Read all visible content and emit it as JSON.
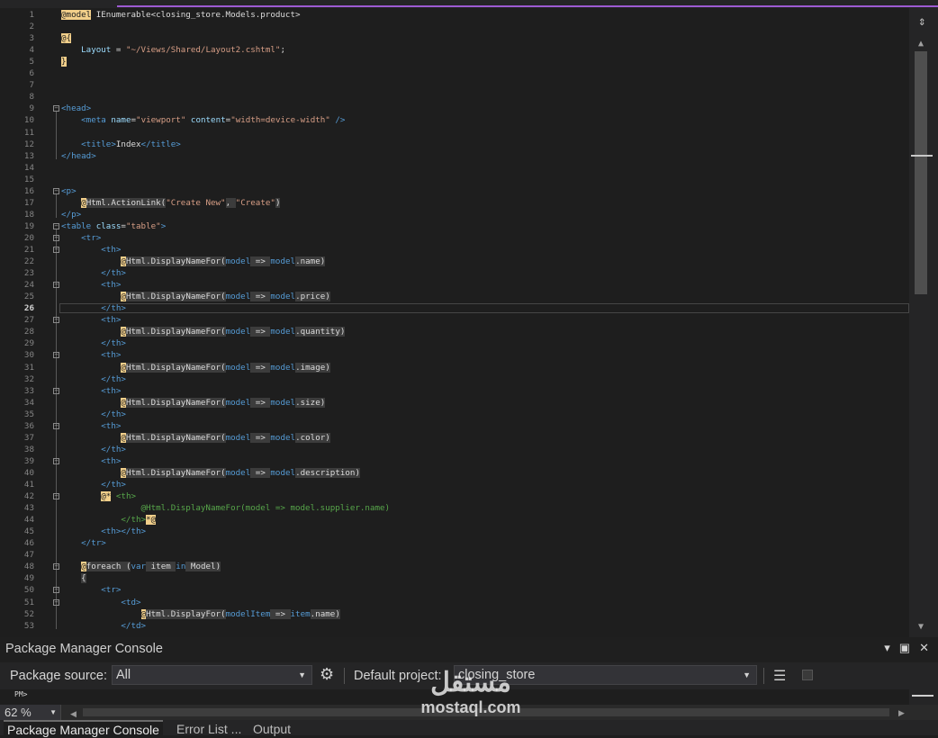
{
  "editor": {
    "current_line": 26,
    "lines": [
      {
        "n": 1,
        "segs": [
          [
            "razor",
            "@model"
          ],
          [
            "type",
            " IEnumerable<closing_store.Models.product>"
          ]
        ]
      },
      {
        "n": 2,
        "segs": []
      },
      {
        "n": 3,
        "segs": [
          [
            "razor",
            "@{"
          ]
        ]
      },
      {
        "n": 4,
        "segs": [
          [
            "plain",
            "    "
          ],
          [
            "prop",
            "Layout"
          ],
          [
            "plain",
            " = "
          ],
          [
            "str",
            "\"~/Views/Shared/Layout2.cshtml\""
          ],
          [
            "plain",
            ";"
          ]
        ]
      },
      {
        "n": 5,
        "segs": [
          [
            "razor",
            "}"
          ]
        ]
      },
      {
        "n": 6,
        "segs": []
      },
      {
        "n": 7,
        "segs": []
      },
      {
        "n": 8,
        "segs": []
      },
      {
        "n": 9,
        "segs": [
          [
            "tag",
            "<head>"
          ]
        ]
      },
      {
        "n": 10,
        "segs": [
          [
            "plain",
            "    "
          ],
          [
            "tag",
            "<meta "
          ],
          [
            "attr",
            "name"
          ],
          [
            "plain",
            "="
          ],
          [
            "str",
            "\"viewport\""
          ],
          [
            "plain",
            " "
          ],
          [
            "attr",
            "content"
          ],
          [
            "plain",
            "="
          ],
          [
            "str",
            "\"width=device-width\""
          ],
          [
            "tag",
            " />"
          ]
        ]
      },
      {
        "n": 11,
        "segs": []
      },
      {
        "n": 12,
        "segs": [
          [
            "plain",
            "    "
          ],
          [
            "tag",
            "<title>"
          ],
          [
            "plain",
            "Index"
          ],
          [
            "tag",
            "</title>"
          ]
        ]
      },
      {
        "n": 13,
        "segs": [
          [
            "tag",
            "</head>"
          ]
        ]
      },
      {
        "n": 14,
        "segs": []
      },
      {
        "n": 15,
        "segs": []
      },
      {
        "n": 16,
        "segs": [
          [
            "tag",
            "<p>"
          ]
        ]
      },
      {
        "n": 17,
        "segs": [
          [
            "plain",
            "    "
          ],
          [
            "razor",
            "@"
          ],
          [
            "rzb",
            "Html.ActionLink("
          ],
          [
            "str",
            "\"Create New\""
          ],
          [
            "rzb",
            ", "
          ],
          [
            "str",
            "\"Create\""
          ],
          [
            "rzb",
            ")"
          ]
        ]
      },
      {
        "n": 18,
        "segs": [
          [
            "tag",
            "</p>"
          ]
        ]
      },
      {
        "n": 19,
        "segs": [
          [
            "tag",
            "<table "
          ],
          [
            "attr",
            "class"
          ],
          [
            "plain",
            "="
          ],
          [
            "str",
            "\"table\""
          ],
          [
            "tag",
            ">"
          ]
        ]
      },
      {
        "n": 20,
        "segs": [
          [
            "plain",
            "    "
          ],
          [
            "tag",
            "<tr>"
          ]
        ]
      },
      {
        "n": 21,
        "segs": [
          [
            "plain",
            "        "
          ],
          [
            "tag",
            "<th>"
          ]
        ]
      },
      {
        "n": 22,
        "segs": [
          [
            "plain",
            "            "
          ],
          [
            "razor",
            "@"
          ],
          [
            "rzb",
            "Html.DisplayNameFor("
          ],
          [
            "kw",
            "model"
          ],
          [
            "rzb",
            " => "
          ],
          [
            "kw",
            "model"
          ],
          [
            "rzb",
            ".name)"
          ]
        ]
      },
      {
        "n": 23,
        "segs": [
          [
            "plain",
            "        "
          ],
          [
            "tag",
            "</th>"
          ]
        ]
      },
      {
        "n": 24,
        "segs": [
          [
            "plain",
            "        "
          ],
          [
            "tag",
            "<th>"
          ]
        ]
      },
      {
        "n": 25,
        "segs": [
          [
            "plain",
            "            "
          ],
          [
            "razor",
            "@"
          ],
          [
            "rzb",
            "Html.DisplayNameFor("
          ],
          [
            "kw",
            "model"
          ],
          [
            "rzb",
            " => "
          ],
          [
            "kw",
            "model"
          ],
          [
            "rzb",
            ".price)"
          ]
        ]
      },
      {
        "n": 26,
        "segs": [
          [
            "plain",
            "        "
          ],
          [
            "tag",
            "</th>"
          ]
        ]
      },
      {
        "n": 27,
        "segs": [
          [
            "plain",
            "        "
          ],
          [
            "tag",
            "<th>"
          ]
        ]
      },
      {
        "n": 28,
        "segs": [
          [
            "plain",
            "            "
          ],
          [
            "razor",
            "@"
          ],
          [
            "rzb",
            "Html.DisplayNameFor("
          ],
          [
            "kw",
            "model"
          ],
          [
            "rzb",
            " => "
          ],
          [
            "kw",
            "model"
          ],
          [
            "rzb",
            ".quantity)"
          ]
        ]
      },
      {
        "n": 29,
        "segs": [
          [
            "plain",
            "        "
          ],
          [
            "tag",
            "</th>"
          ]
        ]
      },
      {
        "n": 30,
        "segs": [
          [
            "plain",
            "        "
          ],
          [
            "tag",
            "<th>"
          ]
        ]
      },
      {
        "n": 31,
        "segs": [
          [
            "plain",
            "            "
          ],
          [
            "razor",
            "@"
          ],
          [
            "rzb",
            "Html.DisplayNameFor("
          ],
          [
            "kw",
            "model"
          ],
          [
            "rzb",
            " => "
          ],
          [
            "kw",
            "model"
          ],
          [
            "rzb",
            ".image)"
          ]
        ]
      },
      {
        "n": 32,
        "segs": [
          [
            "plain",
            "        "
          ],
          [
            "tag",
            "</th>"
          ]
        ]
      },
      {
        "n": 33,
        "segs": [
          [
            "plain",
            "        "
          ],
          [
            "tag",
            "<th>"
          ]
        ]
      },
      {
        "n": 34,
        "segs": [
          [
            "plain",
            "            "
          ],
          [
            "razor",
            "@"
          ],
          [
            "rzb",
            "Html.DisplayNameFor("
          ],
          [
            "kw",
            "model"
          ],
          [
            "rzb",
            " => "
          ],
          [
            "kw",
            "model"
          ],
          [
            "rzb",
            ".size)"
          ]
        ]
      },
      {
        "n": 35,
        "segs": [
          [
            "plain",
            "        "
          ],
          [
            "tag",
            "</th>"
          ]
        ]
      },
      {
        "n": 36,
        "segs": [
          [
            "plain",
            "        "
          ],
          [
            "tag",
            "<th>"
          ]
        ]
      },
      {
        "n": 37,
        "segs": [
          [
            "plain",
            "            "
          ],
          [
            "razor",
            "@"
          ],
          [
            "rzb",
            "Html.DisplayNameFor("
          ],
          [
            "kw",
            "model"
          ],
          [
            "rzb",
            " => "
          ],
          [
            "kw",
            "model"
          ],
          [
            "rzb",
            ".color)"
          ]
        ]
      },
      {
        "n": 38,
        "segs": [
          [
            "plain",
            "        "
          ],
          [
            "tag",
            "</th>"
          ]
        ]
      },
      {
        "n": 39,
        "segs": [
          [
            "plain",
            "        "
          ],
          [
            "tag",
            "<th>"
          ]
        ]
      },
      {
        "n": 40,
        "segs": [
          [
            "plain",
            "            "
          ],
          [
            "razor",
            "@"
          ],
          [
            "rzb",
            "Html.DisplayNameFor("
          ],
          [
            "kw",
            "model"
          ],
          [
            "rzb",
            " => "
          ],
          [
            "kw",
            "model"
          ],
          [
            "rzb",
            ".description)"
          ]
        ]
      },
      {
        "n": 41,
        "segs": [
          [
            "plain",
            "        "
          ],
          [
            "tag",
            "</th>"
          ]
        ]
      },
      {
        "n": 42,
        "segs": [
          [
            "plain",
            "        "
          ],
          [
            "razor",
            "@*"
          ],
          [
            "comment",
            " <th>"
          ]
        ]
      },
      {
        "n": 43,
        "segs": [
          [
            "plain",
            "                "
          ],
          [
            "comment",
            "@Html.DisplayNameFor(model => model.supplier.name)"
          ]
        ]
      },
      {
        "n": 44,
        "segs": [
          [
            "plain",
            "            "
          ],
          [
            "comment",
            "</th>"
          ],
          [
            "razor",
            "*@"
          ]
        ]
      },
      {
        "n": 45,
        "segs": [
          [
            "plain",
            "        "
          ],
          [
            "tag",
            "<th></th>"
          ]
        ]
      },
      {
        "n": 46,
        "segs": [
          [
            "plain",
            "    "
          ],
          [
            "tag",
            "</tr>"
          ]
        ]
      },
      {
        "n": 47,
        "segs": []
      },
      {
        "n": 48,
        "segs": [
          [
            "plain",
            "    "
          ],
          [
            "razor",
            "@"
          ],
          [
            "rzb",
            "foreach ("
          ],
          [
            "kw",
            "var"
          ],
          [
            "rzb",
            " item "
          ],
          [
            "kw",
            "in"
          ],
          [
            "rzb",
            " Model)"
          ]
        ]
      },
      {
        "n": 49,
        "segs": [
          [
            "plain",
            "    "
          ],
          [
            "rzb",
            "{"
          ]
        ]
      },
      {
        "n": 50,
        "segs": [
          [
            "plain",
            "        "
          ],
          [
            "tag",
            "<tr>"
          ]
        ]
      },
      {
        "n": 51,
        "segs": [
          [
            "plain",
            "            "
          ],
          [
            "tag",
            "<td>"
          ]
        ]
      },
      {
        "n": 52,
        "segs": [
          [
            "plain",
            "                "
          ],
          [
            "razor",
            "@"
          ],
          [
            "rzb",
            "Html.DisplayFor("
          ],
          [
            "kw",
            "modelItem"
          ],
          [
            "rzb",
            " => "
          ],
          [
            "kw",
            "item"
          ],
          [
            "rzb",
            ".name)"
          ]
        ]
      },
      {
        "n": 53,
        "segs": [
          [
            "plain",
            "            "
          ],
          [
            "tag",
            "</td>"
          ]
        ]
      }
    ]
  },
  "panel": {
    "title": "Package Manager Console",
    "package_source_label": "Package source:",
    "package_source_value": "All",
    "default_project_label": "Default project:",
    "default_project_value": "closing_store",
    "prompt": "PM>",
    "zoom": "62 %"
  },
  "bottom_tabs": [
    "Package Manager Console",
    "Error List ...",
    "Output"
  ],
  "watermark": {
    "arabic": "مستقل",
    "latin": "mostaql.com"
  }
}
